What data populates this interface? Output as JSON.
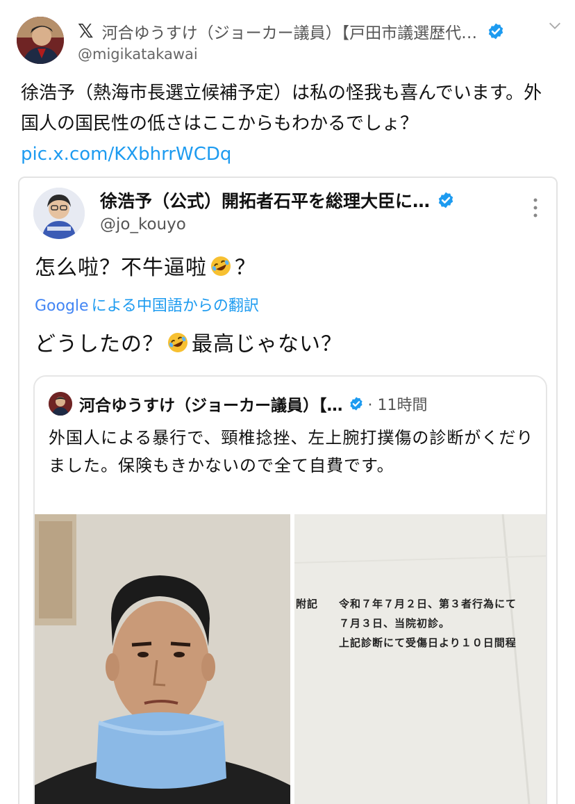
{
  "tweet": {
    "author": {
      "display_name": "河合ゆうすけ（ジョーカー議員）【戸田市議選歴代…",
      "handle": "@migikatakawai"
    },
    "platform_logo": "𝕏",
    "text_before_link": "徐浩予（熱海市長選立候補予定）は私の怪我も喜んでいます。外国人の国民性の低さはここからもわかるでしょ？ ",
    "link": "pic.x.com/KXbhrrWCDq"
  },
  "embedded_tweet": {
    "author": {
      "display_name": "徐浩予（公式）開拓者石平を総理大臣に…",
      "handle": "@jo_kouyo"
    },
    "text_part1": "怎么啦？不牛逼啦",
    "text_part2": "？",
    "translation_brand": "Google",
    "translation_label": "による中国語からの翻訳",
    "translation_part1": "どうしたの？",
    "translation_part2": "最高じゃない？",
    "quoted_tweet": {
      "display_name": "河合ゆうすけ（ジョーカー議員）【…",
      "time": "· 11時間",
      "text": "外国人による暴行で、頸椎捻挫、左上腕打撲傷の診断がくだりました。保険もきかないので全て自費です。",
      "document_lines": {
        "label": "附記",
        "line1": "令和７年７月２日、第３者行為にて",
        "line2": "７月３日、当院初診。",
        "line3": "上記診断にて受傷日より１０日間程"
      }
    }
  },
  "icons": {
    "verified": "verified-badge-icon",
    "caret": "chevron-down-icon",
    "more": "more-vertical-icon",
    "emoji": "rofl-emoji-icon"
  },
  "colors": {
    "link": "#1d9bf0",
    "verified": "#1d9bf0",
    "text": "#111111",
    "muted": "#555555"
  }
}
